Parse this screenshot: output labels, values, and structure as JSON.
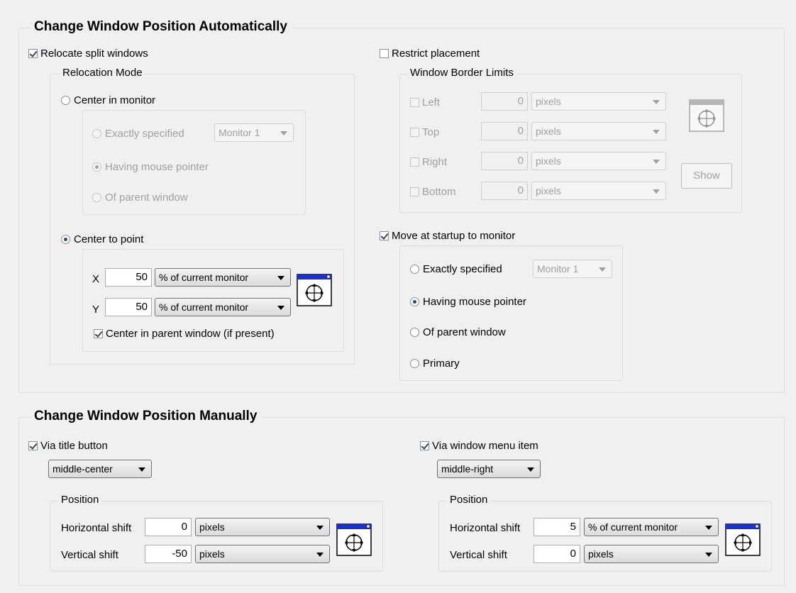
{
  "auto": {
    "title": "Change Window Position Automatically",
    "relocate_label": "Relocate split windows",
    "relocate_checked": true,
    "relocation_mode_title": "Relocation Mode",
    "center_in_monitor_label": "Center in monitor",
    "exactly_specified_label": "Exactly specified",
    "monitor_select": "Monitor 1",
    "having_mouse_pointer_label": "Having mouse pointer",
    "of_parent_window_label": "Of parent window",
    "center_to_point_label": "Center to point",
    "x_label": "X",
    "x_value": "50",
    "x_unit": "% of current monitor",
    "y_label": "Y",
    "y_value": "50",
    "y_unit": "% of current monitor",
    "center_in_parent_label": "Center in parent window (if present)",
    "restrict_label": "Restrict placement",
    "border_limits_title": "Window Border Limits",
    "limits": [
      {
        "label": "Left",
        "value": "0",
        "unit": "pixels"
      },
      {
        "label": "Top",
        "value": "0",
        "unit": "pixels"
      },
      {
        "label": "Right",
        "value": "0",
        "unit": "pixels"
      },
      {
        "label": "Bottom",
        "value": "0",
        "unit": "pixels"
      }
    ],
    "show_button": "Show",
    "move_startup_label": "Move at startup to monitor",
    "startup_exactly_label": "Exactly specified",
    "startup_monitor_select": "Monitor 1",
    "startup_mouse_label": "Having mouse pointer",
    "startup_parent_label": "Of parent window",
    "startup_primary_label": "Primary"
  },
  "manual": {
    "title": "Change Window Position Manually",
    "title_button_label": "Via title button",
    "title_button_select": "middle-center",
    "title_position_title": "Position",
    "title_h_label": "Horizontal shift",
    "title_h_value": "0",
    "title_h_unit": "pixels",
    "title_v_label": "Vertical shift",
    "title_v_value": "-50",
    "title_v_unit": "pixels",
    "menu_item_label": "Via window menu item",
    "menu_item_select": "middle-right",
    "menu_position_title": "Position",
    "menu_h_label": "Horizontal shift",
    "menu_h_value": "5",
    "menu_h_unit": "% of current monitor",
    "menu_v_label": "Vertical shift",
    "menu_v_value": "0",
    "menu_v_unit": "pixels"
  },
  "colors": {
    "accent": "#1a2fd6",
    "group_border": "#d5dfe5"
  }
}
